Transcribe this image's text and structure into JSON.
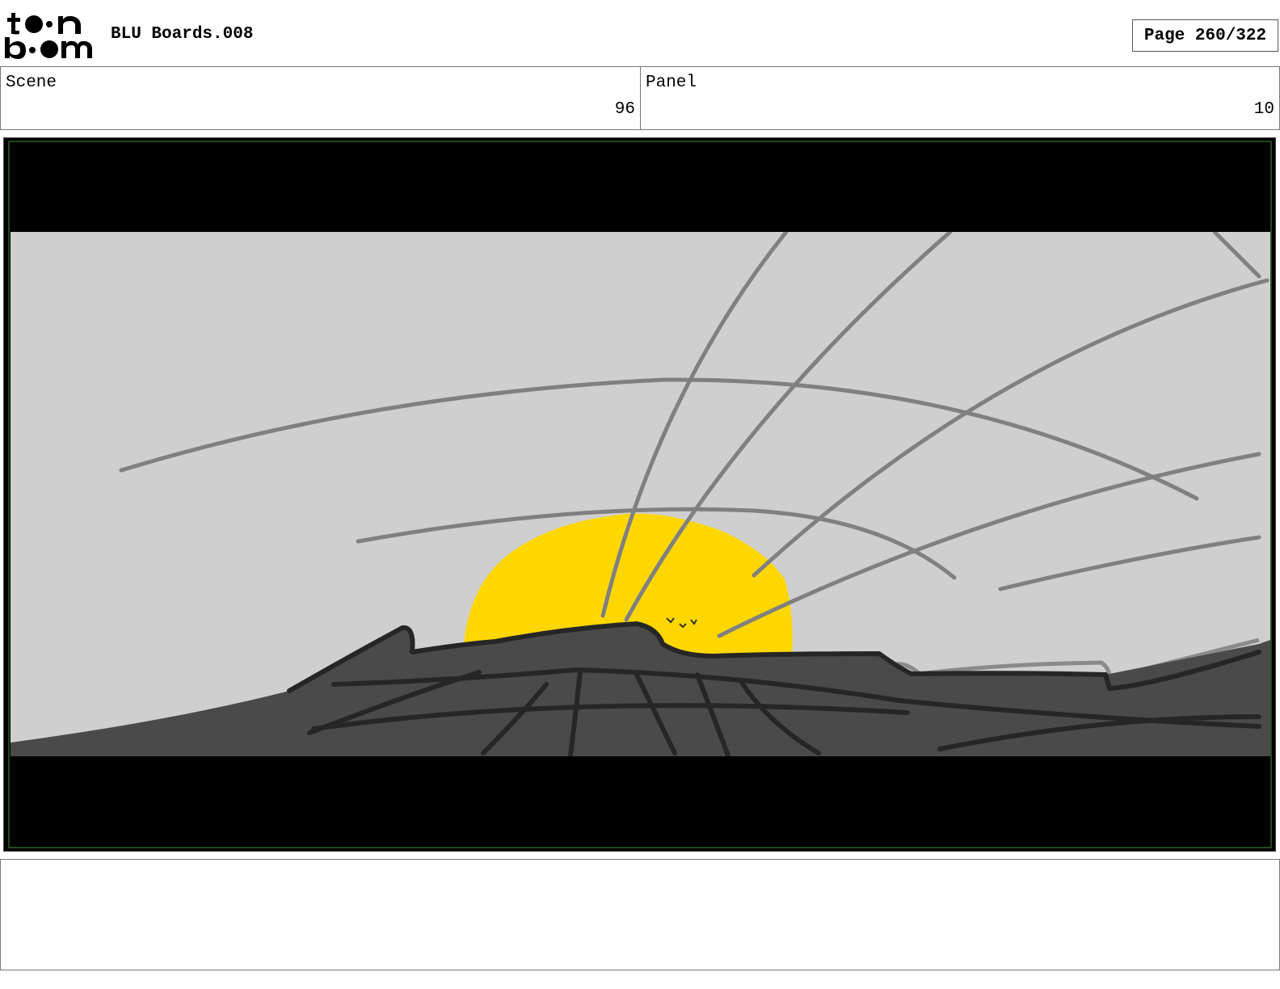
{
  "header": {
    "logo_text": "toon boom",
    "document_title": "BLU Boards.008",
    "page_indicator": "Page 260/322"
  },
  "info": {
    "scene_label": "Scene",
    "scene_value": "96",
    "panel_label": "Panel",
    "panel_value": "10"
  },
  "colors": {
    "sky": "#cfcfcf",
    "sun": "#ffd700",
    "rock": "#4a4a4a",
    "letterbox": "#000000",
    "frame_border": "#1f4a1f"
  },
  "notes": {
    "text": ""
  }
}
